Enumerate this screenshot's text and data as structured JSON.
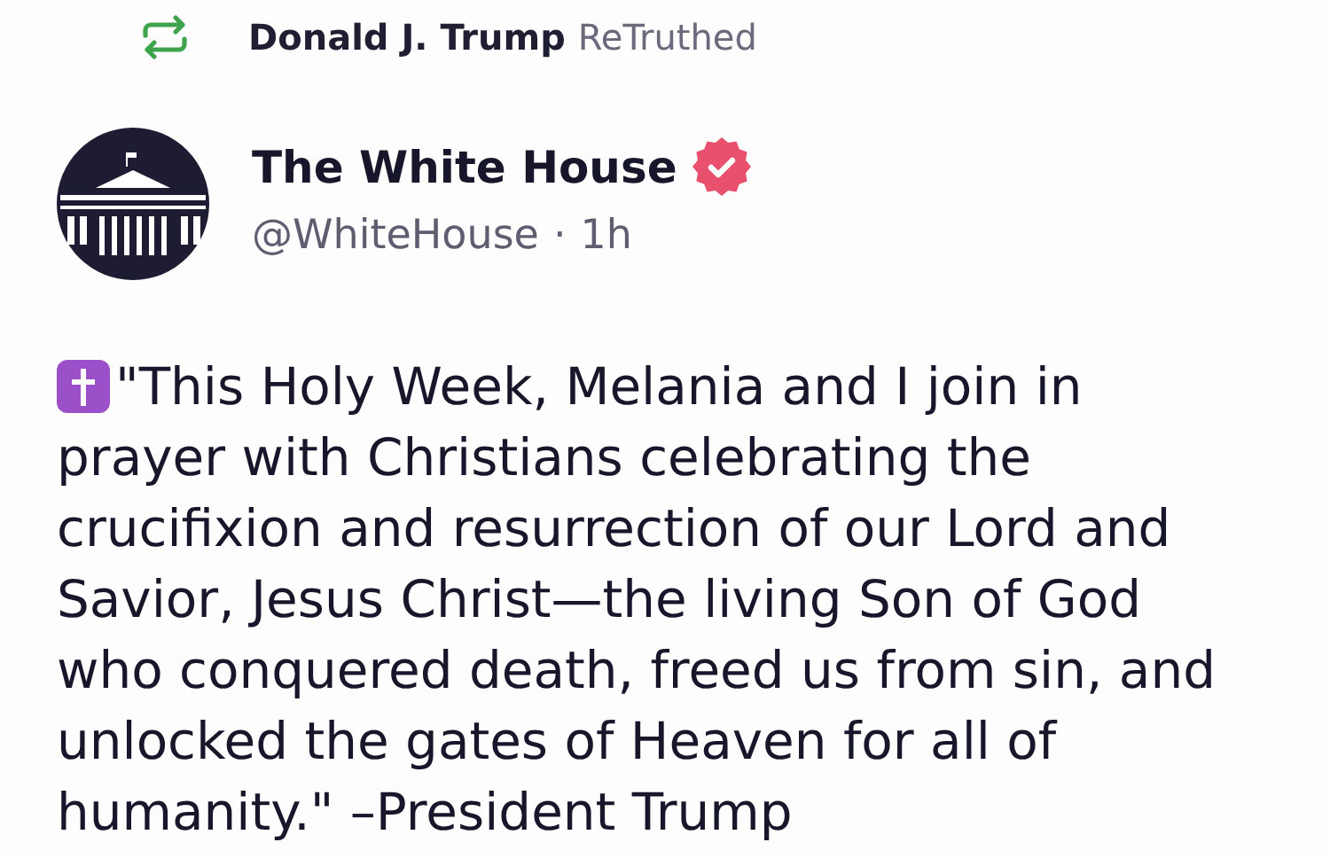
{
  "repost": {
    "user": "Donald J. Trump",
    "action": "ReTruthed"
  },
  "post": {
    "author": {
      "name": "The White House",
      "verified": true,
      "handle": "@WhiteHouse",
      "separator": "·",
      "time": "1h"
    },
    "text_lines": [
      "\"This Holy Week, Melania and I join in",
      "prayer with Christians celebrating the",
      "crucifixion and resurrection of our Lord and",
      "Savior, Jesus Christ—the living Son of God",
      "who conquered death, freed us from sin, and",
      "unlocked the gates of Heaven for all of",
      "humanity.\" –President Trump"
    ]
  }
}
